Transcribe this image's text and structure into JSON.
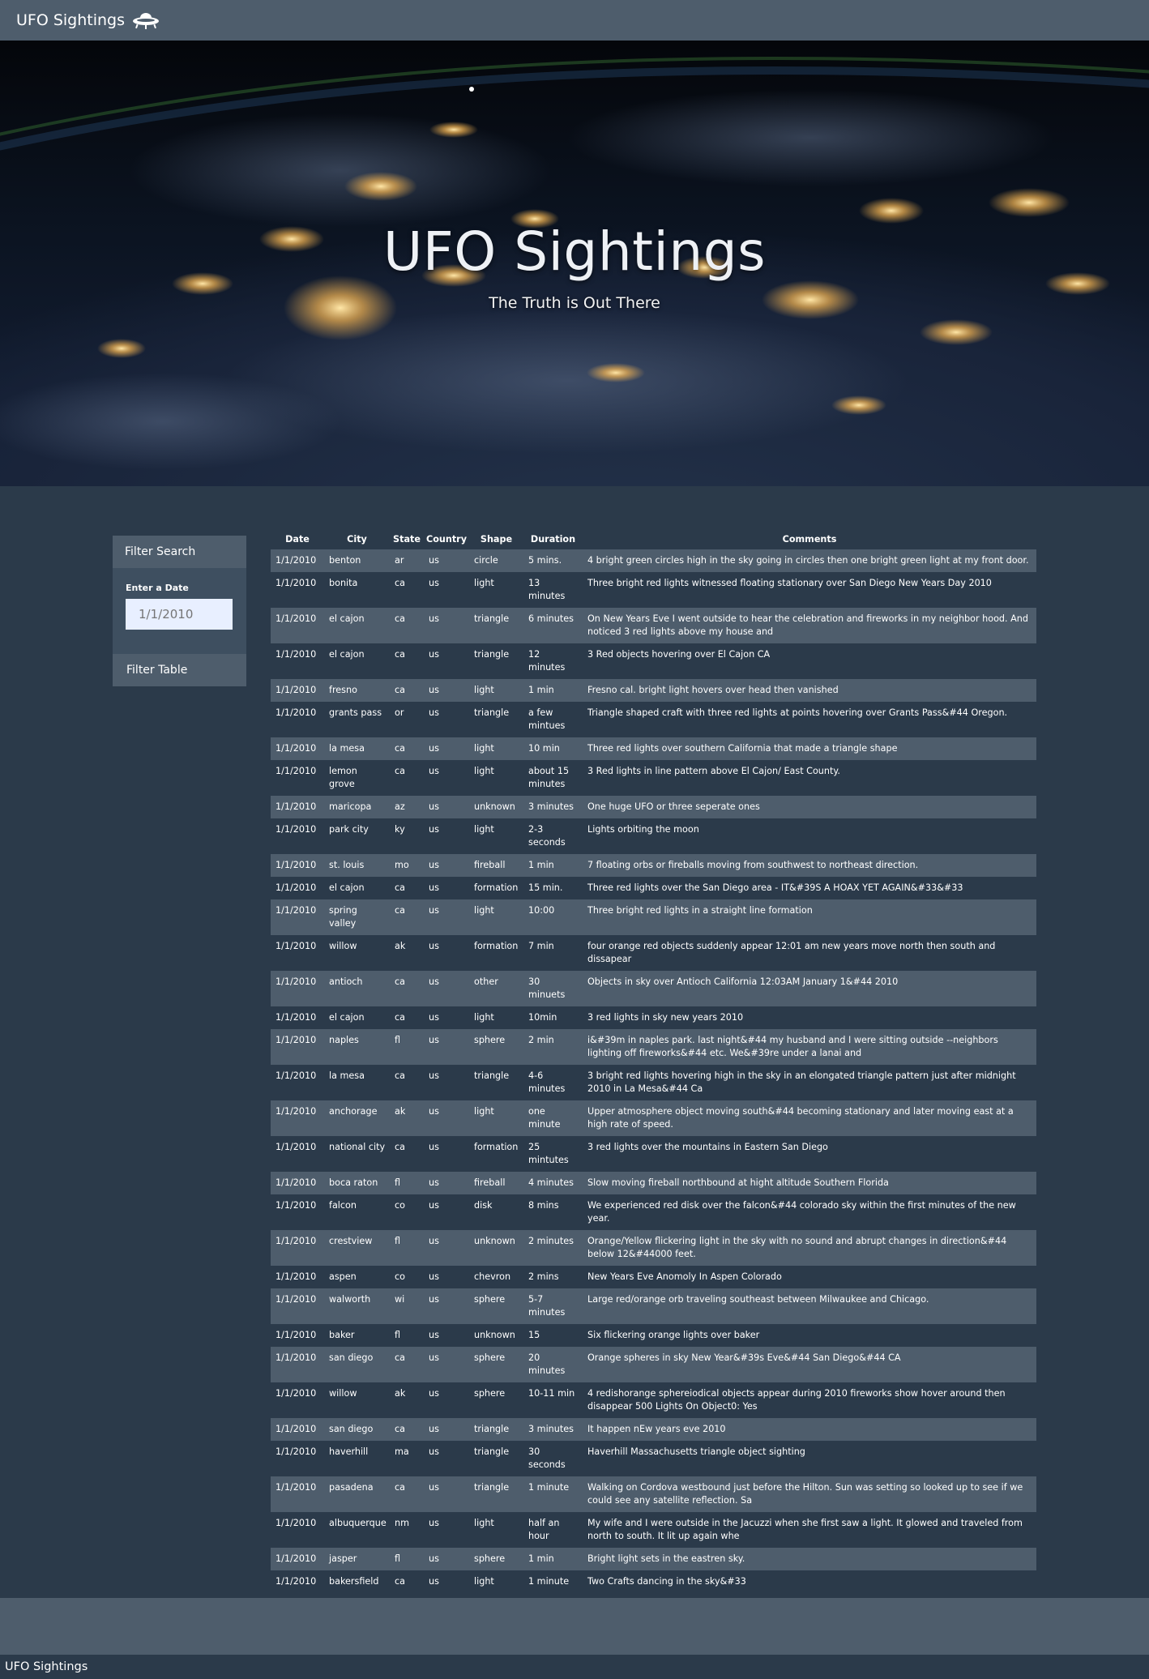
{
  "navbar": {
    "brand": "UFO Sightings",
    "icon": "ufo-icon"
  },
  "hero": {
    "title": "UFO Sightings",
    "subtitle": "The Truth is Out There"
  },
  "filter": {
    "heading": "Filter Search",
    "date_label": "Enter a Date",
    "date_placeholder": "1/1/2010",
    "button_label": "Filter Table"
  },
  "table": {
    "headers": [
      "Date",
      "City",
      "State",
      "Country",
      "Shape",
      "Duration",
      "Comments"
    ],
    "rows": [
      [
        "1/1/2010",
        "benton",
        "ar",
        "us",
        "circle",
        "5 mins.",
        "4 bright green circles high in the sky going in circles then one bright green light at my front door."
      ],
      [
        "1/1/2010",
        "bonita",
        "ca",
        "us",
        "light",
        "13 minutes",
        "Three bright red lights witnessed floating stationary over San Diego New Years Day 2010"
      ],
      [
        "1/1/2010",
        "el cajon",
        "ca",
        "us",
        "triangle",
        "6 minutes",
        "On New Years Eve I went outside to hear the celebration and fireworks in my neighbor hood. And noticed 3 red lights above my house and"
      ],
      [
        "1/1/2010",
        "el cajon",
        "ca",
        "us",
        "triangle",
        "12 minutes",
        "3 Red objects hovering over El Cajon CA"
      ],
      [
        "1/1/2010",
        "fresno",
        "ca",
        "us",
        "light",
        "1 min",
        "Fresno cal. bright light hovers over head then vanished"
      ],
      [
        "1/1/2010",
        "grants pass",
        "or",
        "us",
        "triangle",
        "a few mintues",
        "Triangle shaped craft with three red lights at points hovering over Grants Pass&#44 Oregon."
      ],
      [
        "1/1/2010",
        "la mesa",
        "ca",
        "us",
        "light",
        "10 min",
        "Three red lights over southern California that made a triangle shape"
      ],
      [
        "1/1/2010",
        "lemon grove",
        "ca",
        "us",
        "light",
        "about 15 minutes",
        "3 Red lights in line pattern above El Cajon/ East County."
      ],
      [
        "1/1/2010",
        "maricopa",
        "az",
        "us",
        "unknown",
        "3 minutes",
        "One huge UFO or three seperate ones"
      ],
      [
        "1/1/2010",
        "park city",
        "ky",
        "us",
        "light",
        "2-3 seconds",
        "Lights orbiting the moon"
      ],
      [
        "1/1/2010",
        "st. louis",
        "mo",
        "us",
        "fireball",
        "1 min",
        "7 floating orbs or fireballs moving from southwest to northeast direction."
      ],
      [
        "1/1/2010",
        "el cajon",
        "ca",
        "us",
        "formation",
        "15 min.",
        "Three red lights over the San Diego area - IT&#39S A HOAX YET AGAIN&#33&#33"
      ],
      [
        "1/1/2010",
        "spring valley",
        "ca",
        "us",
        "light",
        "10:00",
        "Three bright red lights in a straight line formation"
      ],
      [
        "1/1/2010",
        "willow",
        "ak",
        "us",
        "formation",
        "7 min",
        "four orange red objects suddenly appear 12:01 am new years move north then south and dissapear"
      ],
      [
        "1/1/2010",
        "antioch",
        "ca",
        "us",
        "other",
        "30 minuets",
        "Objects in sky over Antioch California 12:03AM January 1&#44 2010"
      ],
      [
        "1/1/2010",
        "el cajon",
        "ca",
        "us",
        "light",
        "10min",
        "3 red lights in sky new years 2010"
      ],
      [
        "1/1/2010",
        "naples",
        "fl",
        "us",
        "sphere",
        "2 min",
        "i&#39m in naples park. last night&#44 my husband and I were sitting outside --neighbors lighting off fireworks&#44 etc. We&#39re under a lanai and"
      ],
      [
        "1/1/2010",
        "la mesa",
        "ca",
        "us",
        "triangle",
        "4-6 minutes",
        "3 bright red lights hovering high in the sky in an elongated triangle pattern just after midnight 2010 in La Mesa&#44 Ca"
      ],
      [
        "1/1/2010",
        "anchorage",
        "ak",
        "us",
        "light",
        "one minute",
        "Upper atmosphere object moving south&#44 becoming stationary and later moving east at a high rate of speed."
      ],
      [
        "1/1/2010",
        "national city",
        "ca",
        "us",
        "formation",
        "25 mintutes",
        "3 red lights over the mountains in Eastern San Diego"
      ],
      [
        "1/1/2010",
        "boca raton",
        "fl",
        "us",
        "fireball",
        "4 minutes",
        "Slow moving fireball northbound at hight altitude Southern Florida"
      ],
      [
        "1/1/2010",
        "falcon",
        "co",
        "us",
        "disk",
        "8 mins",
        "We experienced red disk over the falcon&#44 colorado sky within the first minutes of the new year."
      ],
      [
        "1/1/2010",
        "crestview",
        "fl",
        "us",
        "unknown",
        "2 minutes",
        "Orange/Yellow flickering light in the sky with no sound and abrupt changes in direction&#44 below 12&#44000 feet."
      ],
      [
        "1/1/2010",
        "aspen",
        "co",
        "us",
        "chevron",
        "2 mins",
        "New Years Eve Anomoly In Aspen Colorado"
      ],
      [
        "1/1/2010",
        "walworth",
        "wi",
        "us",
        "sphere",
        "5-7 minutes",
        "Large red/orange orb traveling southeast between Milwaukee and Chicago."
      ],
      [
        "1/1/2010",
        "baker",
        "fl",
        "us",
        "unknown",
        "15",
        "Six flickering orange lights over baker"
      ],
      [
        "1/1/2010",
        "san diego",
        "ca",
        "us",
        "sphere",
        "20 minutes",
        "Orange spheres in sky New Year&#39s Eve&#44 San Diego&#44 CA"
      ],
      [
        "1/1/2010",
        "willow",
        "ak",
        "us",
        "sphere",
        "10-11 min",
        "4 redishorange sphereiodical objects appear during 2010 fireworks show hover around then disappear 500 Lights On Object0: Yes"
      ],
      [
        "1/1/2010",
        "san diego",
        "ca",
        "us",
        "triangle",
        "3 minutes",
        "It happen nEw years eve 2010"
      ],
      [
        "1/1/2010",
        "haverhill",
        "ma",
        "us",
        "triangle",
        "30 seconds",
        "Haverhill Massachusetts triangle object sighting"
      ],
      [
        "1/1/2010",
        "pasadena",
        "ca",
        "us",
        "triangle",
        "1 minute",
        "Walking on Cordova westbound just before the Hilton. Sun was setting so looked up to see if we could see any satellite reflection. Sa"
      ],
      [
        "1/1/2010",
        "albuquerque",
        "nm",
        "us",
        "light",
        "half an hour",
        "My wife and I were outside in the Jacuzzi when she first saw a light. It glowed and traveled from north to south. It lit up again whe"
      ],
      [
        "1/1/2010",
        "jasper",
        "fl",
        "us",
        "sphere",
        "1 min",
        "Bright light sets in the eastren sky."
      ],
      [
        "1/1/2010",
        "bakersfield",
        "ca",
        "us",
        "light",
        "1 minute",
        "Two Crafts dancing in the sky&#33"
      ]
    ]
  },
  "footer": {
    "text": "UFO Sightings"
  }
}
